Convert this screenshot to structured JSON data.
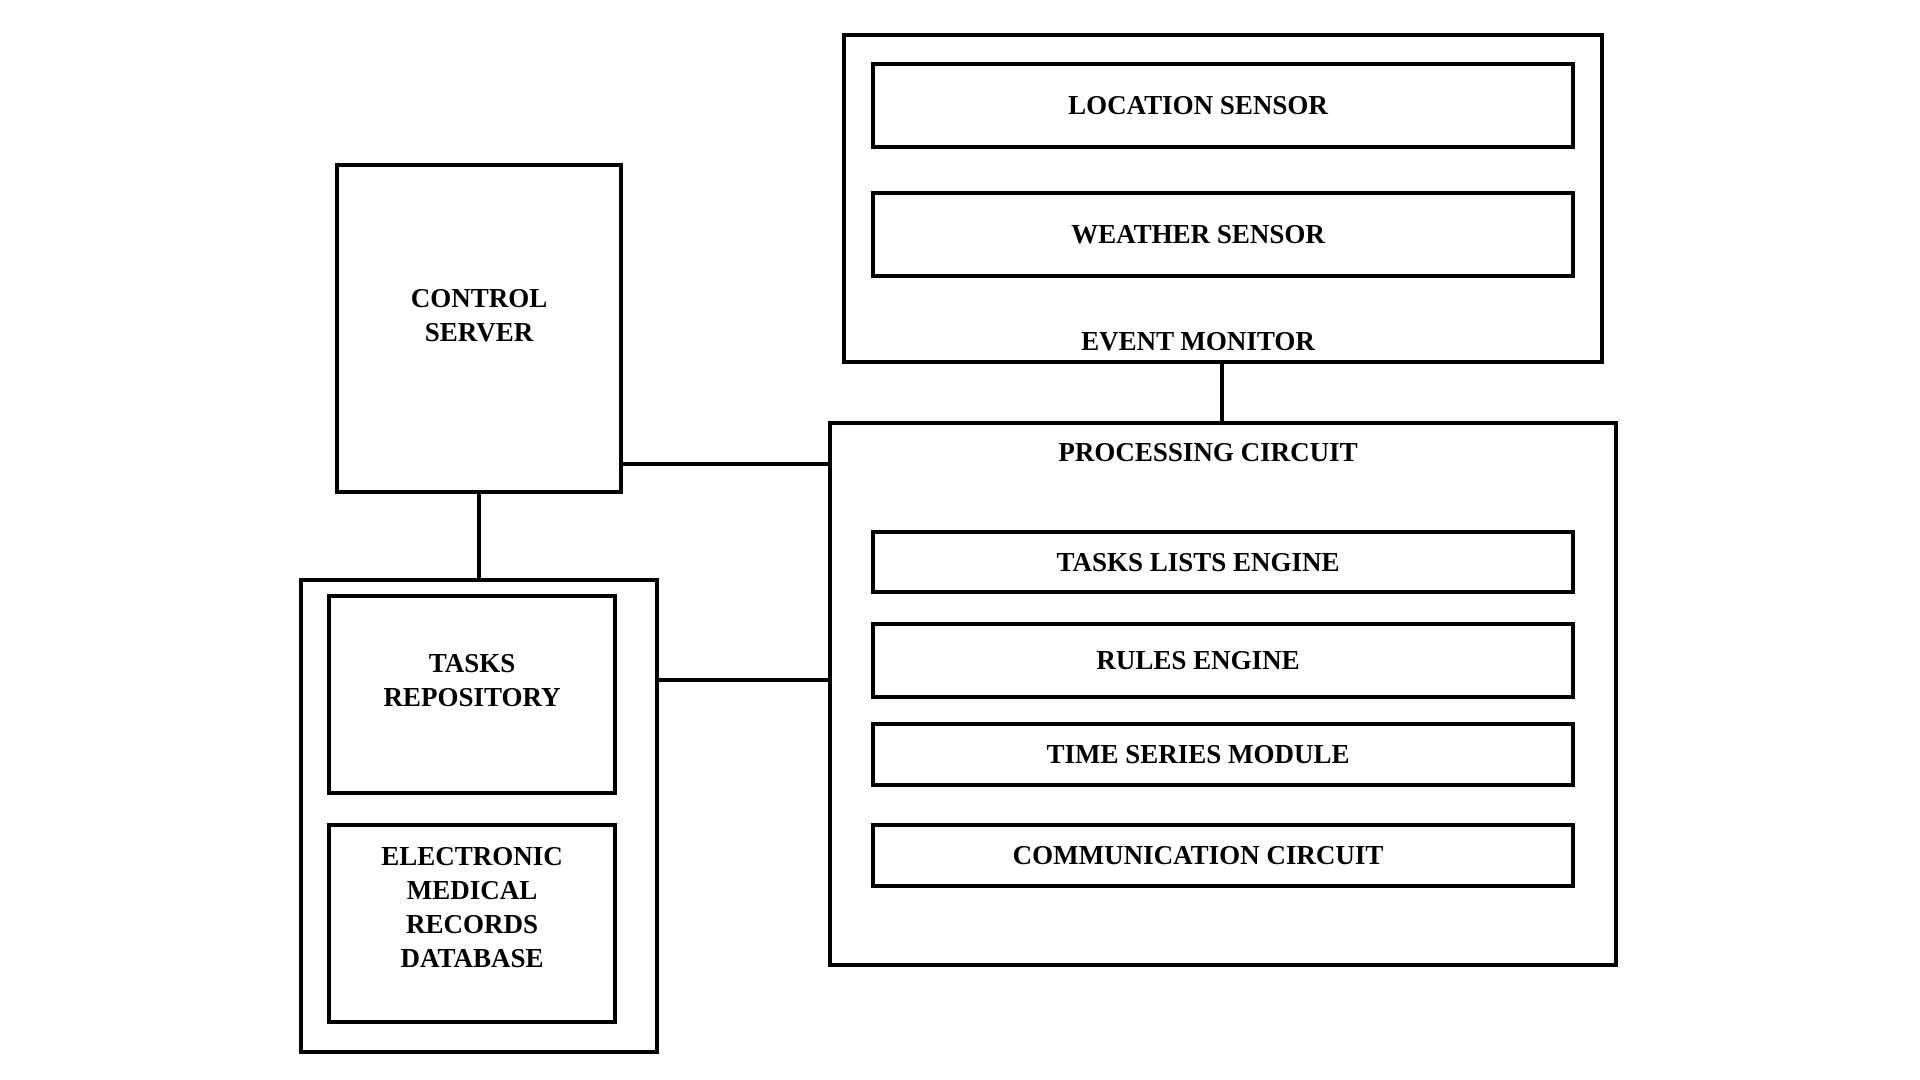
{
  "diagram": {
    "event_monitor": {
      "label": "EVENT MONITOR",
      "children": {
        "location_sensor": "LOCATION SENSOR",
        "weather_sensor": "WEATHER SENSOR"
      }
    },
    "control_server": {
      "label_line1": "CONTROL",
      "label_line2": "SERVER"
    },
    "processing_circuit": {
      "label": "PROCESSING CIRCUIT",
      "children": {
        "tasks_lists_engine": "TASKS LISTS ENGINE",
        "rules_engine": "RULES ENGINE",
        "time_series_module": "TIME SERIES MODULE",
        "communication_circuit": "COMMUNICATION CIRCUIT"
      }
    },
    "storage_group": {
      "tasks_repository": {
        "line1": "TASKS",
        "line2": "REPOSITORY"
      },
      "emr_database": {
        "line1": "ELECTRONIC",
        "line2": "MEDICAL",
        "line3": "RECORDS",
        "line4": "DATABASE"
      }
    },
    "connections": [
      [
        "location_sensor",
        "weather_sensor"
      ],
      [
        "event_monitor",
        "processing_circuit"
      ],
      [
        "control_server",
        "processing_circuit"
      ],
      [
        "control_server",
        "storage_group"
      ],
      [
        "storage_group",
        "processing_circuit"
      ],
      [
        "tasks_repository",
        "emr_database"
      ],
      [
        "tasks_lists_engine",
        "rules_engine"
      ],
      [
        "rules_engine",
        "time_series_module"
      ],
      [
        "time_series_module",
        "communication_circuit"
      ]
    ]
  }
}
